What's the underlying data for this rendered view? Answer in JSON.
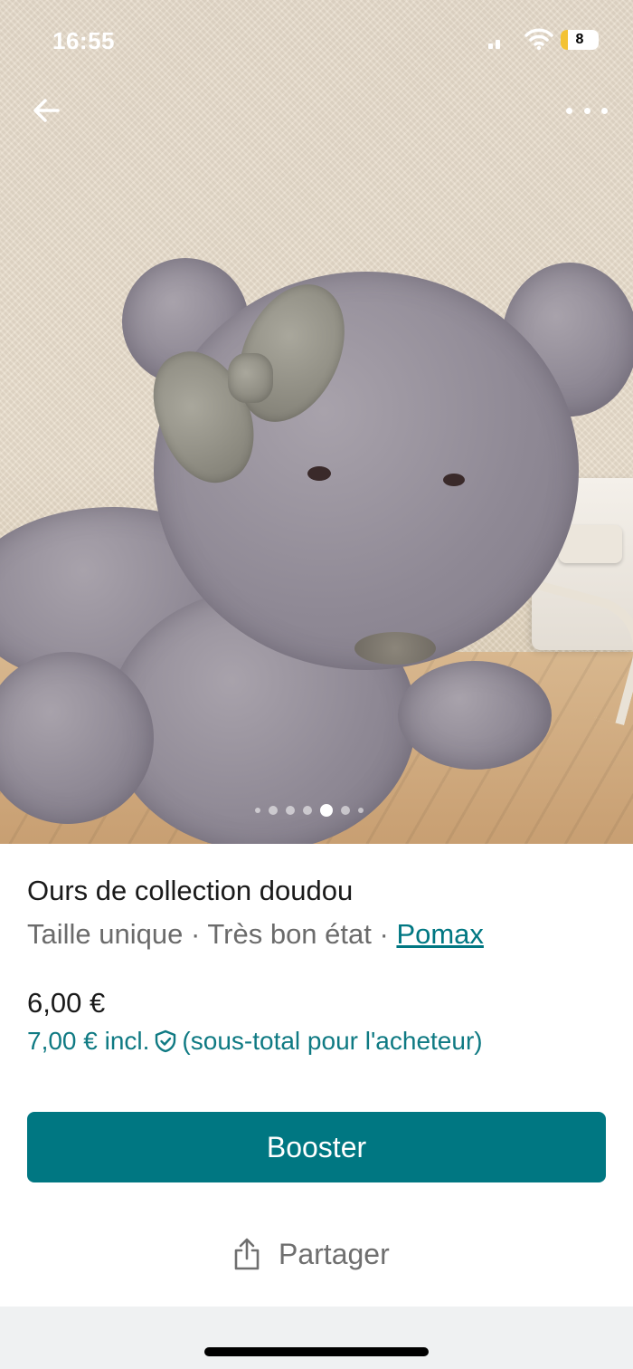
{
  "status_bar": {
    "time": "16:55",
    "battery_level": "8"
  },
  "nav": {
    "back_icon": "arrow-left-icon",
    "more_icon": "ellipsis-icon"
  },
  "gallery": {
    "photo_count": 7,
    "active_index": 4
  },
  "item": {
    "title": "Ours de collection doudou",
    "size": "Taille unique",
    "condition": "Très bon état",
    "separator": " · ",
    "brand": "Pomax",
    "price": "6,00 €",
    "price_incl": "7,00 € incl.",
    "buyer_note": "(sous-total pour l'acheteur)"
  },
  "actions": {
    "booster_label": "Booster",
    "share_label": "Partager"
  },
  "colors": {
    "accent": "#007782",
    "text": "#1a1a1a",
    "muted": "#6b6b6b"
  }
}
